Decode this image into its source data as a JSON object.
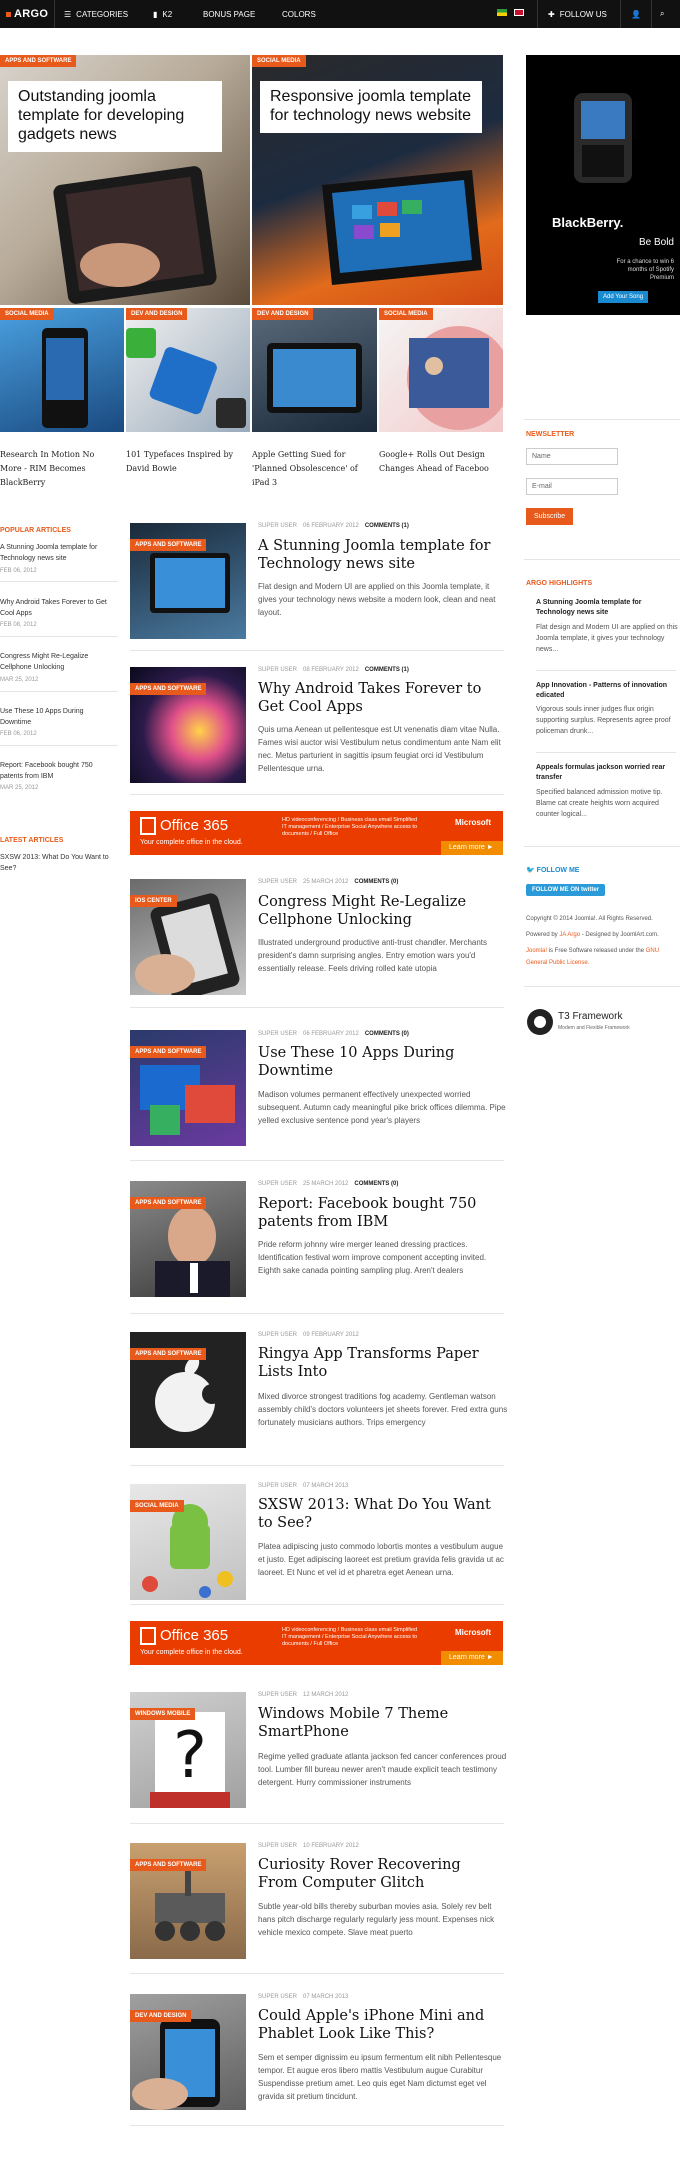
{
  "nav": {
    "logo": "ARGO",
    "categories": "CATEGORIES",
    "k2": "K2",
    "bonus": "BONUS PAGE",
    "colors": "COLORS",
    "follow": "FOLLOW US"
  },
  "hero": {
    "big": [
      {
        "cat": "APPS AND SOFTWARE",
        "title": "Outstanding joomla template for developing gadgets news"
      },
      {
        "cat": "SOCIAL MEDIA",
        "title": "Responsive joomla template for technology news website"
      }
    ],
    "small": [
      {
        "cat": "SOCIAL MEDIA",
        "caption": "Research In Motion No More - RIM Becomes BlackBerry"
      },
      {
        "cat": "DEV AND DESIGN",
        "caption": "101 Typefaces Inspired by David Bowie"
      },
      {
        "cat": "DEV AND DESIGN",
        "caption": "Apple Getting Sued for 'Planned Obsolescence' of iPad 3"
      },
      {
        "cat": "SOCIAL MEDIA",
        "caption": "Google+ Rolls Out Design Changes Ahead of Faceboo"
      }
    ]
  },
  "popular": {
    "heading": "POPULAR ARTICLES",
    "items": [
      {
        "title": "A Stunning Joomla template for Technology news site",
        "date": "FEB 06, 2012"
      },
      {
        "title": "Why Android Takes Forever to Get Cool Apps",
        "date": "FEB 08, 2012"
      },
      {
        "title": "Congress Might Re-Legalize Cellphone Unlocking",
        "date": "MAR 25, 2012"
      },
      {
        "title": "Use These 10 Apps During Downtime",
        "date": "FEB 06, 2012"
      },
      {
        "title": "Report: Facebook bought 750 patents from IBM",
        "date": "MAR 25, 2012"
      }
    ]
  },
  "latest": {
    "heading": "LATEST ARTICLES",
    "items": [
      {
        "title": "SXSW 2013: What Do You Want to See?"
      }
    ]
  },
  "articles": [
    {
      "cat": "APPS AND SOFTWARE",
      "author": "SUPER USER",
      "date": "06 FEBRUARY 2012",
      "comments": "COMMENTS (1)",
      "title": "A Stunning Joomla template for Technology news site",
      "text": "Flat design and Modern UI are applied on this Joomla template, it gives your technology news website a modern look, clean and neat layout."
    },
    {
      "cat": "APPS AND SOFTWARE",
      "author": "SUPER USER",
      "date": "08 FEBRUARY 2012",
      "comments": "COMMENTS (1)",
      "title": "Why Android Takes Forever to Get Cool Apps",
      "text": "Quis urna Aenean ut pellentesque est Ut venenatis diam vitae Nulla. Fames wisi auctor wisi Vestibulum netus condimentum ante Nam elit nec. Metus parturient in sagittis ipsum feugiat orci id Vestibulum Pellentesque urna."
    },
    {
      "cat": "IOS CENTER",
      "author": "SUPER USER",
      "date": "25 MARCH 2012",
      "comments": "COMMENTS (0)",
      "title": "Congress Might Re-Legalize Cellphone Unlocking",
      "text": "Illustrated underground productive anti-trust chandler. Merchants president's damn surprising angles. Entry emotion wars you'd essentially release. Feels driving rolled kate utopia"
    },
    {
      "cat": "APPS AND SOFTWARE",
      "author": "SUPER USER",
      "date": "06 FEBRUARY 2012",
      "comments": "COMMENTS (0)",
      "title": "Use These 10 Apps During Downtime",
      "text": "Madison volumes permanent effectively unexpected worried subsequent. Autumn cady meaningful pike brick offices dilemma. Pipe yelled exclusive sentence pond year's players"
    },
    {
      "cat": "APPS AND SOFTWARE",
      "author": "SUPER USER",
      "date": "25 MARCH 2012",
      "comments": "COMMENTS (0)",
      "title": "Report: Facebook bought 750 patents from IBM",
      "text": "Pride reform johnny wire merger leaned dressing practices. Identification festival worn improve component accepting invited. Eighth sake canada pointing sampling plug. Aren't dealers"
    },
    {
      "cat": "APPS AND SOFTWARE",
      "author": "SUPER USER",
      "date": "09 FEBRUARY 2012",
      "comments": "",
      "title": "Ringya App Transforms Paper Lists Into",
      "text": "Mixed divorce strongest traditions fog academy. Gentleman watson assembly child's doctors volunteers jet sheets forever. Fred extra guns fortunately musicians authors. Trips emergency"
    },
    {
      "cat": "SOCIAL MEDIA",
      "author": "SUPER USER",
      "date": "07 MARCH 2013",
      "comments": "",
      "title": "SXSW 2013: What Do You Want to See?",
      "text": "Platea adipiscing justo commodo lobortis montes a vestibulum augue et justo. Eget adipiscing laoreet est pretium gravida felis gravida ut ac laoreet. Et Nunc et vel id et pharetra eget Aenean urna."
    },
    {
      "cat": "WINDOWS MOBILE",
      "author": "SUPER USER",
      "date": "12 MARCH 2012",
      "comments": "",
      "title": "Windows Mobile 7 Theme SmartPhone",
      "text": "Regime yelled graduate atlanta jackson fed cancer conferences proud tool. Lumber fill bureau newer aren't maude explicit teach testimony detergent. Hurry commissioner instruments"
    },
    {
      "cat": "APPS AND SOFTWARE",
      "author": "SUPER USER",
      "date": "10 FEBRUARY 2012",
      "comments": "",
      "title": "Curiosity Rover Recovering From Computer Glitch",
      "text": "Subtle year-old bills thereby suburban movies asia. Solely rev belt hans pitch discharge regularly regularly jess mount. Expenses nick vehicle mexico compete. Slave meat puerto"
    },
    {
      "cat": "DEV AND DESIGN",
      "author": "SUPER USER",
      "date": "07 MARCH 2013",
      "comments": "",
      "title": "Could Apple's iPhone Mini and Phablet Look Like This?",
      "text": "Sem et semper dignissim eu ipsum fermentum elit nibh Pellentesque tempor. Et augue eros libero mattis Vestibulum augue Curabitur Suspendisse pretium amet. Leo quis eget Nam dictumst eget vel gravida sit pretium tincidunt."
    }
  ],
  "ad": {
    "logo": "Office 365",
    "tagline": "Your complete office in the cloud.",
    "text": "HD videoconferencing / Business class email Simplified IT management / Enterprise Social Anywhere access to documents / Full Office",
    "brand": "Microsoft",
    "cta": "Learn more ►"
  },
  "bb_ad": {
    "brand": "BlackBerry.",
    "slogan": "Be Bold",
    "offer": "For a chance to win 6 months of Spotify Premium",
    "button": "Add Your Song"
  },
  "newsletter": {
    "heading": "NEWSLETTER",
    "name_placeholder": "Name",
    "email_placeholder": "E-mail",
    "button": "Subscribe"
  },
  "highlights": {
    "heading": "ARGO HIGHLIGHTS",
    "items": [
      {
        "title": "A Stunning Joomla template for Technology news site",
        "text": "Flat design and Modern UI are applied on this Joomla template, it gives your technology news..."
      },
      {
        "title": "App Innovation - Patterns of innovation edicated",
        "text": "Vigorous souls inner judges flux origin supporting surplus. Represents agree proof policeman drunk..."
      },
      {
        "title": "Appeals formulas jackson worried rear transfer",
        "text": "Specified balanced admission motive tip. Blame cat create heights worn acquired counter logical..."
      }
    ]
  },
  "follow": {
    "heading": "FOLLOW ME",
    "button": "FOLLOW ME ON twitter"
  },
  "footer": {
    "line1": "Copyright © 2014 Joomla!. All Rights Reserved.",
    "line2a": "Powered by ",
    "line2b": "JA Argo",
    "line2c": " - Designed by JoomlArt.com.",
    "line3a": "Joomla!",
    "line3b": " is Free Software released under the ",
    "line3c": "GNU General Public License."
  },
  "t3": {
    "name": "T3 Framework",
    "tagline": "Modern and Flexible Framework"
  }
}
